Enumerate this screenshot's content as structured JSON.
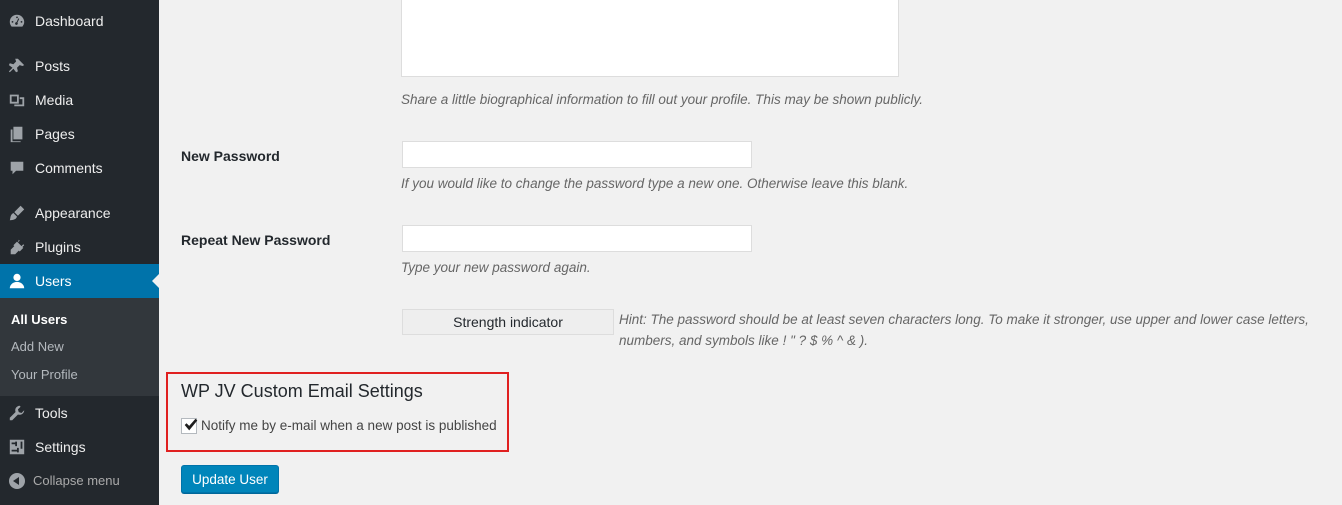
{
  "menu": {
    "items": [
      {
        "label": "Dashboard",
        "icon": "dashboard-icon"
      },
      {
        "label": "Posts",
        "icon": "pin-icon"
      },
      {
        "label": "Media",
        "icon": "media-icon"
      },
      {
        "label": "Pages",
        "icon": "pages-icon"
      },
      {
        "label": "Comments",
        "icon": "comment-icon"
      },
      {
        "label": "Appearance",
        "icon": "brush-icon"
      },
      {
        "label": "Plugins",
        "icon": "plug-icon"
      },
      {
        "label": "Users",
        "icon": "user-icon"
      },
      {
        "label": "Tools",
        "icon": "wrench-icon"
      },
      {
        "label": "Settings",
        "icon": "settings-icon"
      }
    ],
    "submenu": [
      "All Users",
      "Add New",
      "Your Profile"
    ],
    "collapse_label": "Collapse menu"
  },
  "form": {
    "bio_description": "Share a little biographical information to fill out your profile. This may be shown publicly.",
    "new_password_label": "New Password",
    "new_password_desc": "If you would like to change the password type a new one. Otherwise leave this blank.",
    "repeat_password_label": "Repeat New Password",
    "repeat_password_desc": "Type your new password again.",
    "strength_indicator": "Strength indicator",
    "hint": "Hint: The password should be at least seven characters long. To make it stronger, use upper and lower case letters, numbers, and symbols like ! \" ? $ % ^ & )."
  },
  "custom_email": {
    "title": "WP JV Custom Email Settings",
    "notify_label": "Notify me by e-mail when a new post is published",
    "notify_checked": true
  },
  "update_button": "Update User",
  "colors": {
    "menu_bg": "#23282d",
    "submenu_bg": "#32373c",
    "accent": "#0073aa",
    "highlight_border": "#e02020"
  }
}
